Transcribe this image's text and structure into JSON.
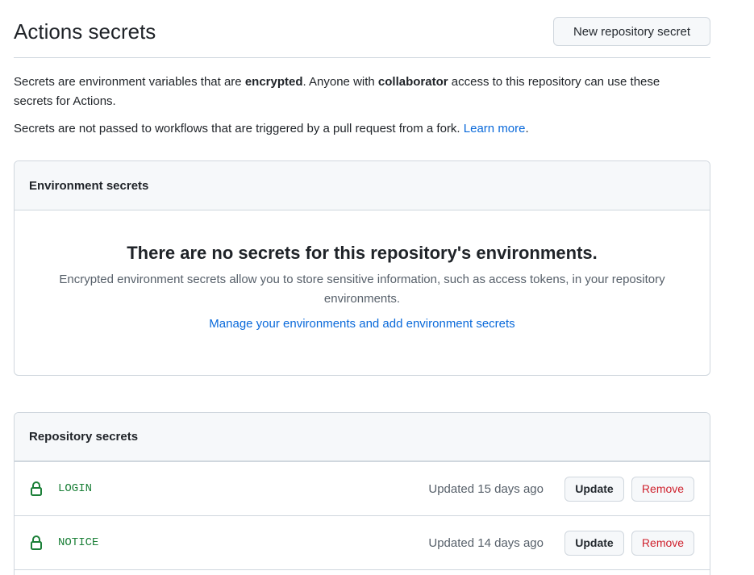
{
  "header": {
    "title": "Actions secrets",
    "new_secret_button": "New repository secret"
  },
  "intro": {
    "line1_part1": "Secrets are environment variables that are ",
    "line1_bold1": "encrypted",
    "line1_part2": ". Anyone with ",
    "line1_bold2": "collaborator",
    "line1_part3": " access to this repository can use these secrets for Actions.",
    "line2_text": "Secrets are not passed to workflows that are triggered by a pull request from a fork. ",
    "line2_link": "Learn more",
    "line2_end": "."
  },
  "environment_secrets": {
    "heading": "Environment secrets",
    "empty_title": "There are no secrets for this repository's environments.",
    "empty_description": "Encrypted environment secrets allow you to store sensitive information, such as access tokens, in your repository environments.",
    "manage_link": "Manage your environments and add environment secrets"
  },
  "repository_secrets": {
    "heading": "Repository secrets",
    "secrets": [
      {
        "name": "LOGIN",
        "updated": "Updated 15 days ago",
        "update_label": "Update",
        "remove_label": "Remove",
        "icon": "lock-icon"
      },
      {
        "name": "NOTICE",
        "updated": "Updated 14 days ago",
        "update_label": "Update",
        "remove_label": "Remove",
        "icon": "lock-icon"
      }
    ]
  },
  "colors": {
    "link": "#0969da",
    "secret_name": "#1a7f37",
    "danger": "#cf222e",
    "border": "#d0d7de",
    "header_bg": "#f6f8fa"
  }
}
